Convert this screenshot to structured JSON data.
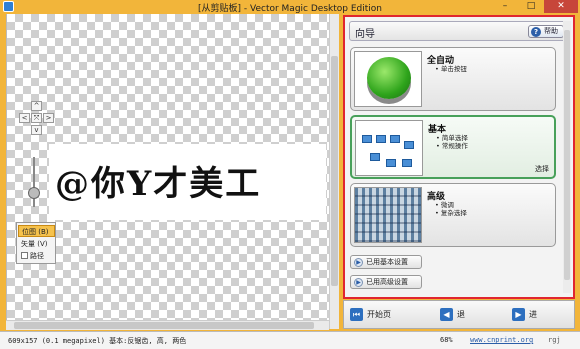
{
  "window": {
    "title": "[从剪贴板] - Vector Magic Desktop Edition",
    "minimize_glyph": "–",
    "maximize_glyph": "□",
    "close_glyph": "✕"
  },
  "canvas": {
    "artwork_text": "@你Y才美工"
  },
  "nav_controls": {
    "up": "^",
    "left": "<",
    "fit": "⤧",
    "right": ">",
    "down": "v"
  },
  "view_modes": {
    "bitmap_label": "位图 (B)",
    "vector_label": "矢量 (V)",
    "paths_label": "路径"
  },
  "wizard": {
    "title": "向导",
    "help_label": "帮助",
    "options": [
      {
        "label": "全自动",
        "bullets": [
          "单击按钮"
        ],
        "selected_label": ""
      },
      {
        "label": "基本",
        "bullets": [
          "简单选择",
          "常规操作"
        ],
        "selected_label": "选择"
      },
      {
        "label": "高级",
        "bullets": [
          "微调",
          "复杂选择"
        ],
        "selected_label": ""
      }
    ],
    "basic_settings_label": "已用基本设置",
    "advanced_settings_label": "已用高级设置"
  },
  "bottom_nav": {
    "start_label": "开始页",
    "back_label": "退",
    "next_label": "进"
  },
  "status_bar": {
    "image_info": "609x157 (0.1 megapixel)  基本:反锯齿, 高, 两色",
    "zoom": "68%",
    "link": "www.cnprint.org",
    "version": "rgj"
  }
}
